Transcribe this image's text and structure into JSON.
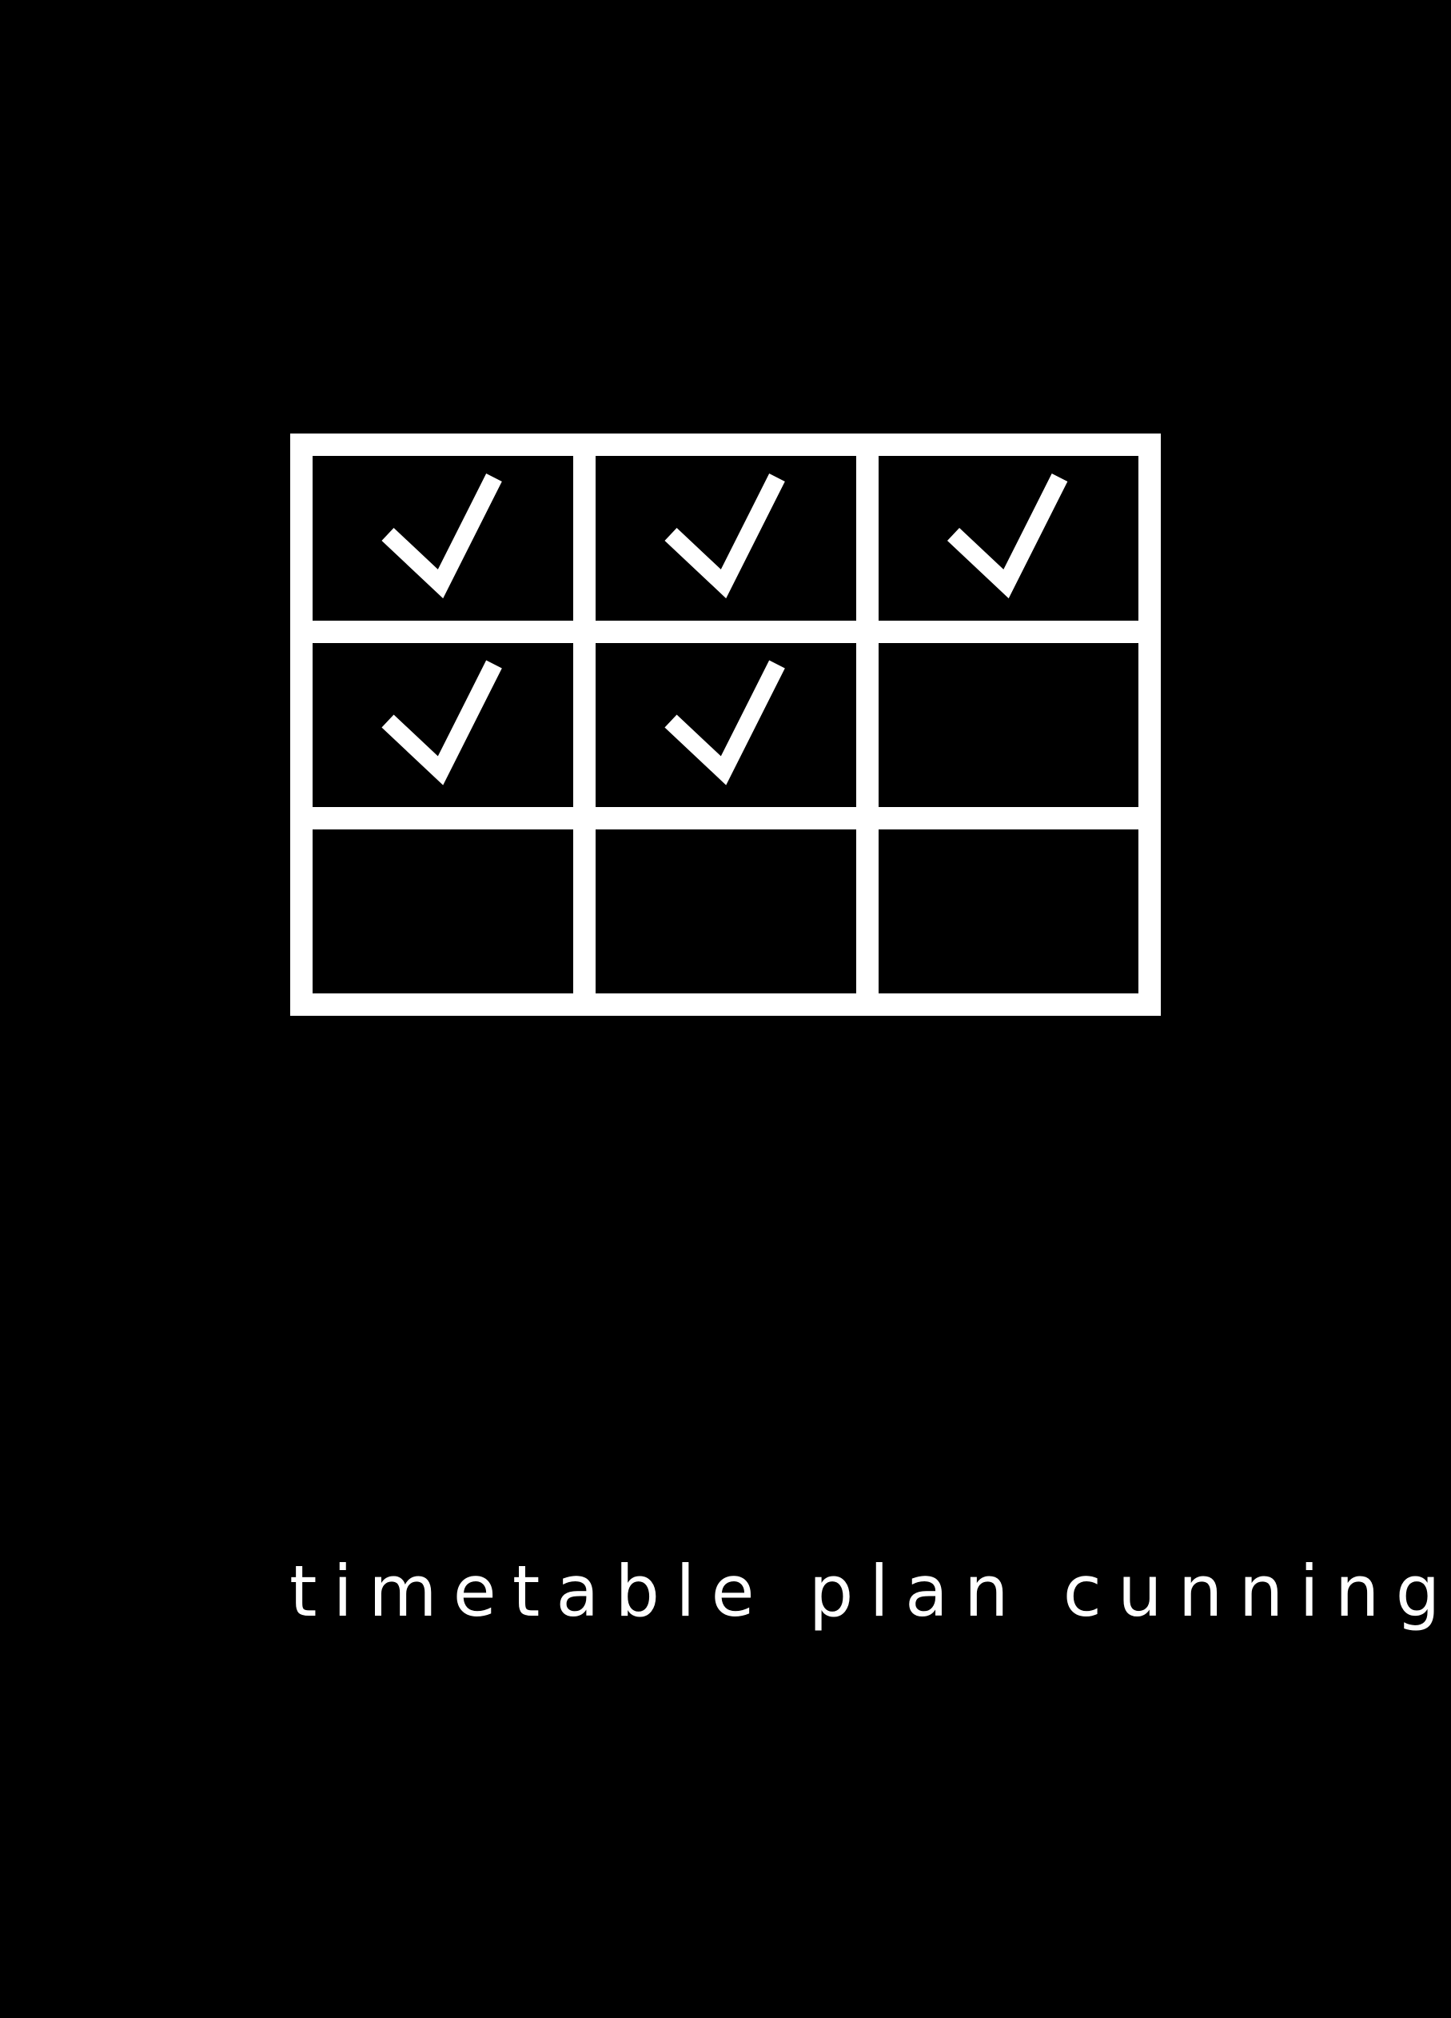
{
  "colors": {
    "background": "#000000",
    "foreground": "#ffffff"
  },
  "grid": {
    "rows": 3,
    "columns": 3,
    "cells": [
      [
        true,
        true,
        true
      ],
      [
        true,
        true,
        false
      ],
      [
        false,
        false,
        false
      ]
    ],
    "check_icon": "checkmark-icon"
  },
  "caption": "timetable plan cunning"
}
